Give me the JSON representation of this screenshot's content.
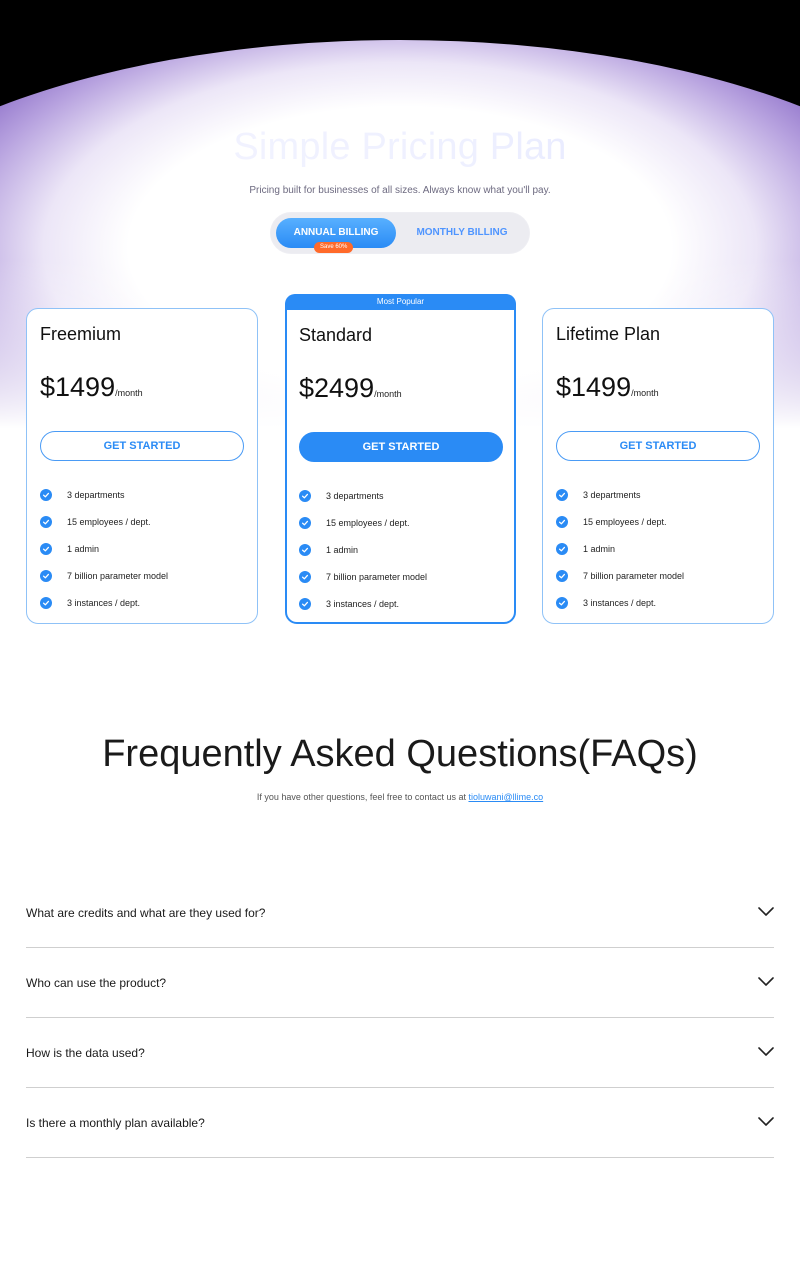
{
  "hero": {
    "title": "Simple Pricing Plan",
    "subtitle": "Pricing built for businesses of all sizes. Always know what you'll pay."
  },
  "billing": {
    "annual_label": "ANNUAL BILLING",
    "monthly_label": "MONTHLY BILLING",
    "save_badge": "Save 60%",
    "selected": "annual"
  },
  "plans": [
    {
      "name": "Freemium",
      "price": "$1499",
      "period": "/month",
      "cta": "GET STARTED",
      "features": [
        "3 departments",
        "15 employees / dept.",
        "1 admin",
        "7 billion parameter model",
        "3 instances / dept."
      ]
    },
    {
      "ribbon": "Most Popular",
      "name": "Standard",
      "price": "$2499",
      "period": "/month",
      "cta": "GET STARTED",
      "features": [
        "3 departments",
        "15 employees / dept.",
        "1 admin",
        "7 billion parameter model",
        "3 instances / dept."
      ]
    },
    {
      "name": "Lifetime Plan",
      "price": "$1499",
      "period": "/month",
      "cta": "GET STARTED",
      "features": [
        "3 departments",
        "15 employees / dept.",
        "1 admin",
        "7 billion parameter model",
        "3 instances / dept."
      ]
    }
  ],
  "faq": {
    "title": "Frequently Asked Questions(FAQs)",
    "subtitle": "If you have other questions, feel free to contact us at",
    "email": "tioluwani@llime.co",
    "items": [
      "What are credits and what are they used for?",
      "Who can use the product?",
      "How is the data used?",
      "Is there a monthly plan available?"
    ]
  },
  "colors": {
    "accent": "#2a8bf5",
    "badge": "#ff6a2a",
    "hero_glow": "#8c6ec8"
  }
}
